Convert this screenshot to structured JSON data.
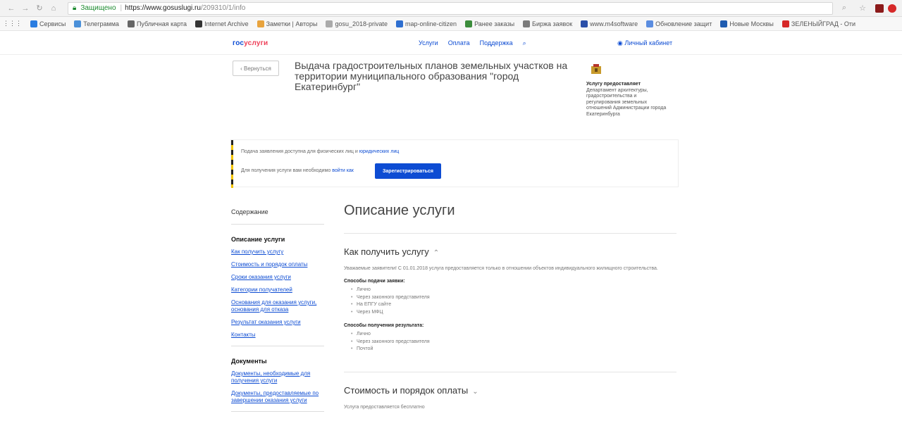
{
  "browser": {
    "secure_label": "Защищено",
    "url_host": "https://www.gosuslugi.ru",
    "url_path": "/209310/1/info",
    "bookmarks": [
      "Сервисы",
      "Телеграмма",
      "Публичная карта",
      "Internet Archive",
      "Заметки | Авторы",
      "gosu_2018-private",
      "map-online-citizen",
      "Ранее заказы",
      "Биржа заявок",
      "www.m4software",
      "Обновление защит",
      "Новые Москвы",
      "ЗЕЛЕНЫЙГРАД - Оти"
    ]
  },
  "header": {
    "logo_a": "гос",
    "logo_b": "услуги",
    "nav": [
      "Услуги",
      "Оплата",
      "Поддержка"
    ],
    "search_icon": "search-icon",
    "cabinet": "Личный кабинет"
  },
  "service": {
    "back": "‹ Вернуться",
    "title": "Выдача градостроительных планов земельных участков на территории муниципального образования \"город Екатеринбург\"",
    "provider_label": "Услугу предоставляет",
    "provider_name": "Департамент архитектуры, градостроительства и регулирования земельных отношений Администрации города Екатеринбурга"
  },
  "notice": {
    "line1_prefix": "Подача заявления доступна для физических лиц и",
    "line1_link": "юридических лиц",
    "line2_prefix": "Для получения услуги вам необходимо",
    "line2_link": "войти как",
    "signup": "Зарегистрироваться"
  },
  "leftnav": {
    "contents": "Содержание",
    "section1": "Описание услуги",
    "links1": [
      "Как получить услугу",
      "Стоимость и порядок оплаты",
      "Сроки оказания услуги",
      "Категории получателей",
      "Основания для оказания услуги, основания для отказа",
      "Результат оказания услуги",
      "Контакты"
    ],
    "section2": "Документы",
    "links2": [
      "Документы, необходимые для получения услуги",
      "Документы, предоставляемые по завершении оказания услуги"
    ]
  },
  "main": {
    "h1": "Описание услуги",
    "how_title": "Как получить услугу",
    "how_text": "Уважаемые заявители! С 01.01.2018 услуга предоставляется только в отношении объектов индивидуального жилищного строительства.",
    "submit_title": "Способы подачи заявки:",
    "submit_items": [
      "Лично",
      "Через законного представителя",
      "На ЕПГУ сайте",
      "Через МФЦ"
    ],
    "result_title": "Способы получения результата:",
    "result_items": [
      "Лично",
      "Через законного представителя",
      "Почтой"
    ],
    "cost_title": "Стоимость и порядок оплаты",
    "cost_text": "Услуга предоставляется бесплатно"
  },
  "colors": {
    "brand_blue": "#0d4cd3",
    "brand_red": "#ee3f58",
    "stripe_yellow": "#f3c400"
  }
}
